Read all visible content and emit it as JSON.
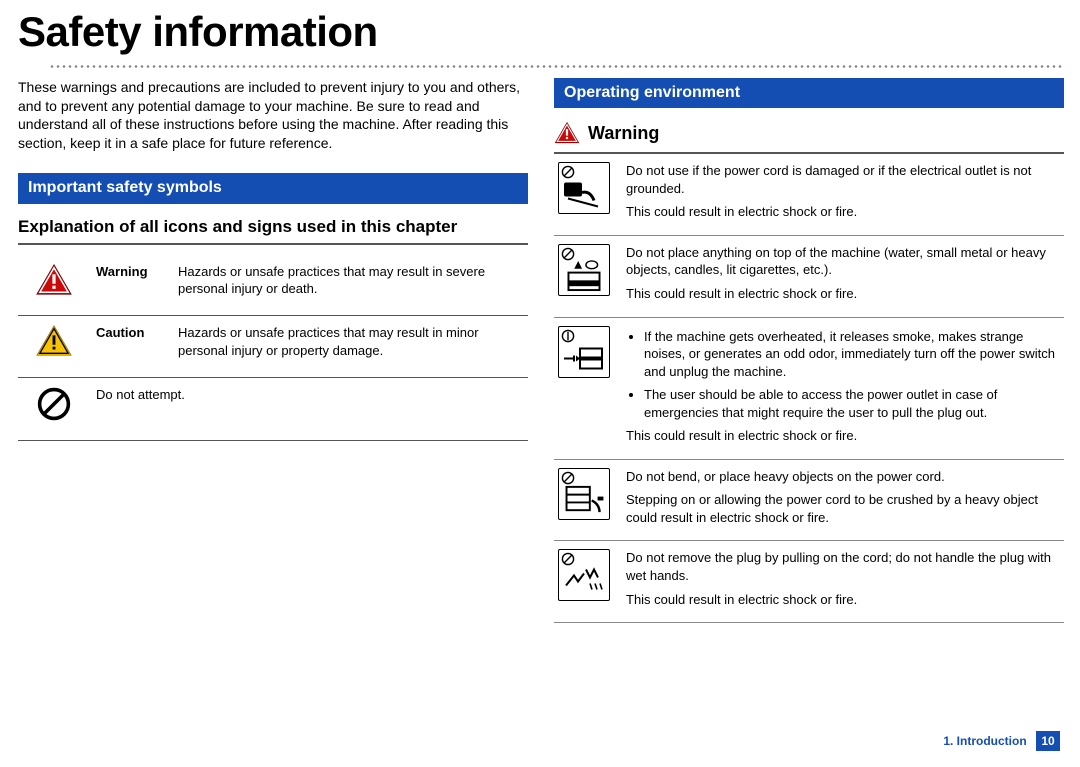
{
  "title": "Safety information",
  "intro": "These warnings and precautions are included to prevent injury to you and others, and to prevent any potential damage to your machine. Be sure to read and understand all of these instructions before using the machine. After reading this section, keep it in a safe place for future reference.",
  "left": {
    "sectionHead": "Important safety symbols",
    "subhead": "Explanation of all icons and signs used in this chapter",
    "rows": [
      {
        "label": "Warning",
        "desc": "Hazards or unsafe practices that may result in severe personal injury or death."
      },
      {
        "label": "Caution",
        "desc": "Hazards or unsafe practices that may result in minor personal injury or property damage."
      },
      {
        "label": "",
        "desc": "Do not attempt."
      }
    ]
  },
  "right": {
    "sectionHead": "Operating environment",
    "warningLabel": "Warning",
    "rows": [
      {
        "line1": "Do not use if the power cord is damaged or if the electrical outlet is not grounded.",
        "line2": "This could result in electric shock or fire."
      },
      {
        "line1": "Do not place anything on top of the machine (water, small metal or heavy objects, candles, lit cigarettes, etc.).",
        "line2": "This could result in electric shock or fire."
      },
      {
        "b1": "If the machine gets overheated, it releases smoke, makes strange noises, or generates an odd odor, immediately turn off the power switch and unplug the machine.",
        "b2": "The user should be able to access the power outlet in case of emergencies that might require the user to pull the plug out.",
        "line2": "This could result in electric shock or fire."
      },
      {
        "line1": "Do not bend, or place heavy objects on the power cord.",
        "line2": "Stepping on or allowing the power cord to be crushed by a heavy object could result in electric shock or fire."
      },
      {
        "line1": "Do not remove the plug by pulling on the cord; do not handle the plug with wet hands.",
        "line2": "This could result in electric shock or fire."
      }
    ]
  },
  "footer": {
    "chapter": "1. Introduction",
    "page": "10"
  }
}
